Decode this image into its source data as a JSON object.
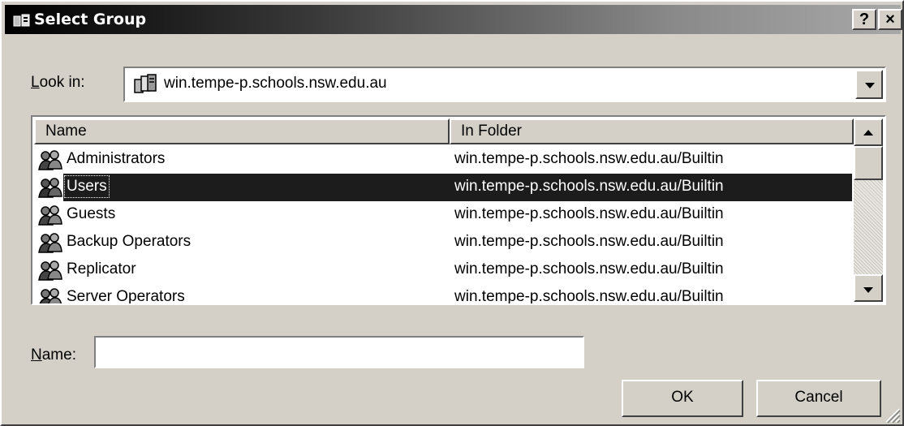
{
  "window": {
    "title": "Select Group",
    "help_label": "?",
    "close_label": "×"
  },
  "look_in": {
    "label_accel": "L",
    "label_rest": "ook in:",
    "value": "win.tempe-p.schools.nsw.edu.au"
  },
  "list": {
    "columns": [
      "Name",
      "In Folder"
    ],
    "rows": [
      {
        "name": "Administrators",
        "folder": "win.tempe-p.schools.nsw.edu.au/Builtin"
      },
      {
        "name": "Users",
        "folder": "win.tempe-p.schools.nsw.edu.au/Builtin",
        "selected": true
      },
      {
        "name": "Guests",
        "folder": "win.tempe-p.schools.nsw.edu.au/Builtin"
      },
      {
        "name": "Backup Operators",
        "folder": "win.tempe-p.schools.nsw.edu.au/Builtin"
      },
      {
        "name": "Replicator",
        "folder": "win.tempe-p.schools.nsw.edu.au/Builtin"
      },
      {
        "name": "Server Operators",
        "folder": "win.tempe-p.schools.nsw.edu.au/Builtin"
      }
    ]
  },
  "name_field": {
    "label_accel": "N",
    "label_rest": "ame:",
    "value": ""
  },
  "buttons": {
    "ok": "OK",
    "cancel": "Cancel"
  },
  "colors": {
    "face": "#d4d0c8",
    "selection": "#1c1c1c"
  }
}
